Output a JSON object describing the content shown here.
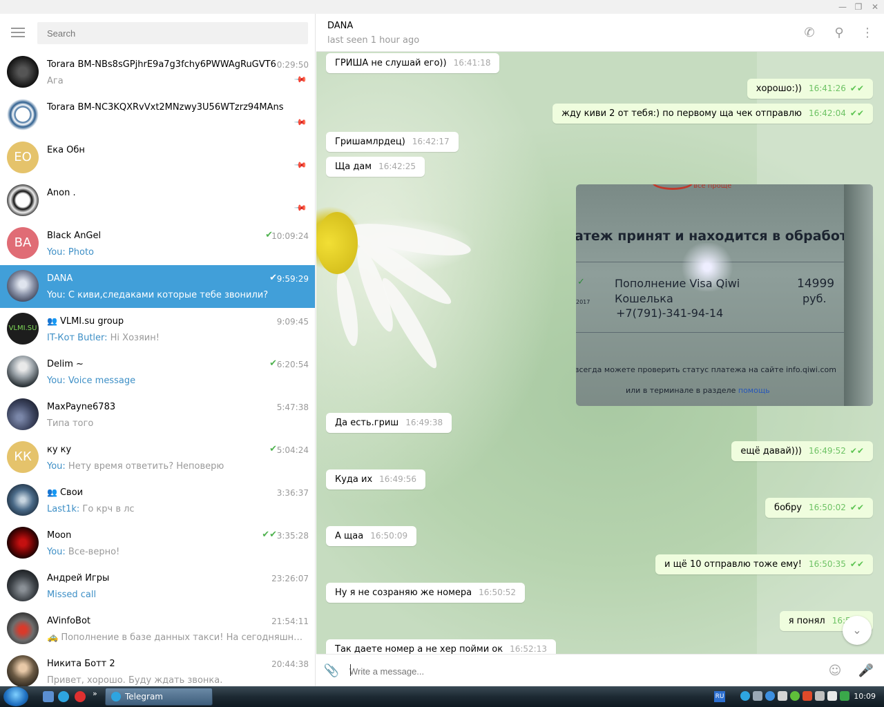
{
  "window": {
    "minimize": "—",
    "maximize": "❐",
    "close": "✕"
  },
  "sidebar": {
    "search_placeholder": "Search",
    "chats": [
      {
        "name": "Torara BM-NBs8sGPjhrE9a7g3fchy6PWWAgRuGVT6",
        "time": "0:29:50",
        "preview": "Ага",
        "pinned": true
      },
      {
        "name": "Torara BM-NC3KQXRvVxt2MNzwy3U56WTzrz94MAns",
        "time": "",
        "preview": "",
        "pinned": true
      },
      {
        "name": "Ека Обн",
        "initials": "EO",
        "time": "",
        "preview": "",
        "pinned": true
      },
      {
        "name": "Anon .",
        "time": "",
        "preview": "",
        "pinned": true
      },
      {
        "name": "Black AnGel",
        "initials": "BA",
        "time": "10:09:24",
        "sender": "You: ",
        "preview": "Photo"
      },
      {
        "name": "DANA",
        "time": "9:59:29",
        "sender": "You: ",
        "preview": "С киви,следаками которые тебе звонили?"
      },
      {
        "name": "VLMI.su group",
        "time": "9:09:45",
        "sender": "IT-Кот Butler: ",
        "preview": "Hi Хозяин!"
      },
      {
        "name": "Delim ~",
        "time": "6:20:54",
        "sender": "You: ",
        "preview": "Voice message"
      },
      {
        "name": "MaxPayne6783",
        "time": "5:47:38",
        "preview": "Типа того"
      },
      {
        "name": "ку ку",
        "initials": "КК",
        "time": "5:04:24",
        "sender": "You: ",
        "preview": "Нету время ответить? Неповерю"
      },
      {
        "name": "Свои",
        "time": "3:36:37",
        "sender": "Last1k: ",
        "preview": "Го крч в лс"
      },
      {
        "name": "Moon",
        "time": "3:35:28",
        "sender": "You: ",
        "preview": "Все-верно!"
      },
      {
        "name": "Андрей Игры",
        "time": "23:26:07",
        "preview": "Missed call"
      },
      {
        "name": "AVinfoBot",
        "time": "21:54:11",
        "preview": "🚕 Пополнение в базе данных такси! На сегодняшний ден..."
      },
      {
        "name": "Никита Ботт 2",
        "time": "20:44:38",
        "preview": "Привет, хорошо.  Буду ждать звонка."
      }
    ]
  },
  "chat": {
    "title": "DANA",
    "status": "last seen 1 hour ago",
    "messages": [
      {
        "text": "ГРИША не слушай его))",
        "time": "16:41:18"
      },
      {
        "text": "хорошо:))",
        "time": "16:41:26"
      },
      {
        "text": "жду киви 2 от тебя:) по первому ща чек отправлю",
        "time": "16:42:04"
      },
      {
        "text": "Гришамлрдец)",
        "time": "16:42:17"
      },
      {
        "text": "Ща дам",
        "time": "16:42:25"
      },
      {
        "text": "Да  есть.гриш",
        "time": "16:49:38"
      },
      {
        "text": "ещё давай)))",
        "time": "16:49:52"
      },
      {
        "text": "Куда их",
        "time": "16:49:56"
      },
      {
        "text": "бобру",
        "time": "16:50:02"
      },
      {
        "text": "А щаа",
        "time": "16:50:09"
      },
      {
        "text": "и щё 10 отправлю тоже ему!",
        "time": "16:50:35"
      },
      {
        "text": "Ну я не созраняю же номера",
        "time": "16:50:52"
      },
      {
        "text": "я понял",
        "time": "16:51:0"
      },
      {
        "text": "Так даете номер а не хер пойми ок",
        "time": "16:52:13"
      }
    ],
    "photo": {
      "brand": "все проще",
      "heading": "атеж принят и находится в обработке",
      "line1": "Пополнение Visa Qiwi",
      "line2": "Кошелька",
      "phone": "+7(791)-341-94-14",
      "amount": "14999",
      "currency": "руб.",
      "year": "2017",
      "note": "всегда можете проверить статус платежа на сайте info.qiwi.com",
      "note2": "или в терминале в разделе",
      "help_link": "помощь"
    },
    "composer_placeholder": "Write a message..."
  },
  "taskbar": {
    "app_label": "Telegram",
    "lang": "RU",
    "clock": "10:09",
    "more": "»"
  }
}
